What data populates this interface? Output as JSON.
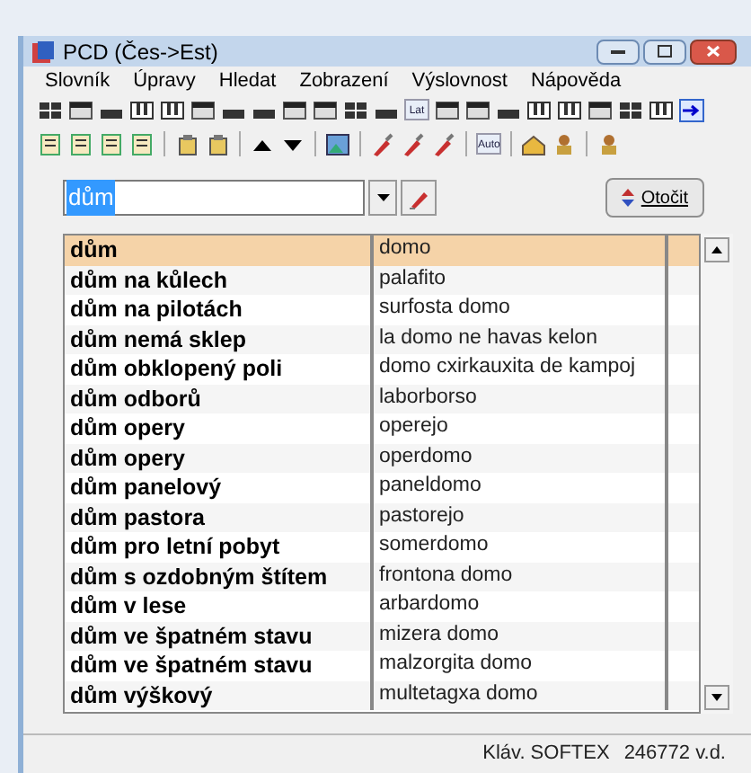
{
  "window": {
    "title": "PCD (Čes->Est)"
  },
  "menu": [
    "Slovník",
    "Úpravy",
    "Hledat",
    "Zobrazení",
    "Výslovnost",
    "Nápověda"
  ],
  "toolbar_1": {
    "icon_text": "Lat"
  },
  "toolbar_2": {
    "icon_text": "Auto"
  },
  "search": {
    "value": "dům",
    "text_selected": true,
    "button": "Otočit"
  },
  "rows": [
    {
      "czech": "dům",
      "esperanto": "domo",
      "selected": true
    },
    {
      "czech": "dům na kůlech",
      "esperanto": "palafito",
      "selected": false
    },
    {
      "czech": "dům na pilotách",
      "esperanto": "surfosta domo",
      "selected": false
    },
    {
      "czech": "dům nemá sklep",
      "esperanto": "la domo ne havas kelon",
      "selected": false
    },
    {
      "czech": "dům obklopený poli",
      "esperanto": "domo cxirkauxita de kampoj",
      "selected": false
    },
    {
      "czech": "dům odborů",
      "esperanto": "laborborso",
      "selected": false
    },
    {
      "czech": "dům opery",
      "esperanto": "operejo",
      "selected": false
    },
    {
      "czech": "dům opery",
      "esperanto": "operdomo",
      "selected": false
    },
    {
      "czech": "dům panelový",
      "esperanto": "paneldomo",
      "selected": false
    },
    {
      "czech": "dům pastora",
      "esperanto": "pastorejo",
      "selected": false
    },
    {
      "czech": "dům pro letní pobyt",
      "esperanto": "somerdomo",
      "selected": false
    },
    {
      "czech": "dům s ozdobným štítem",
      "esperanto": "frontona domo",
      "selected": false
    },
    {
      "czech": "dům v lese",
      "esperanto": "arbardomo",
      "selected": false
    },
    {
      "czech": "dům ve špatném stavu",
      "esperanto": "mizera domo",
      "selected": false
    },
    {
      "czech": "dům ve špatném stavu",
      "esperanto": "malzorgita domo",
      "selected": false
    },
    {
      "czech": "dům výškový",
      "esperanto": "multetagxa domo",
      "selected": false
    }
  ],
  "status_bar": [
    "Kláv. SOFTEX",
    "246772 v.d."
  ]
}
